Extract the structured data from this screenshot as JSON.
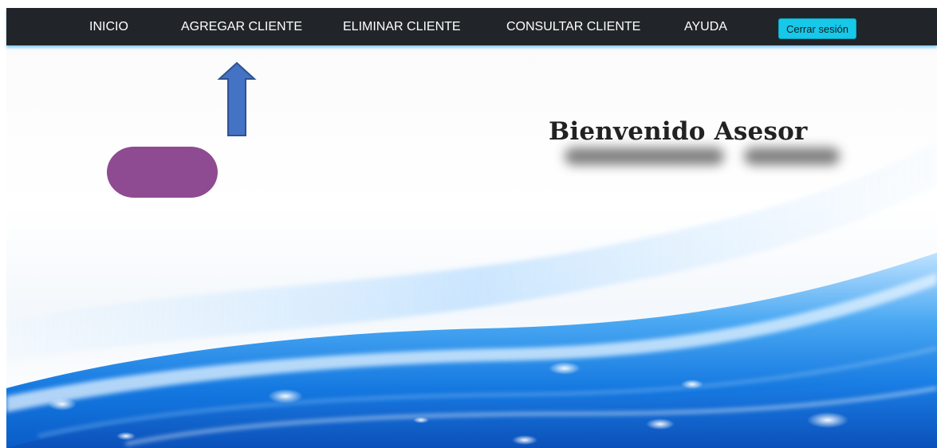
{
  "navbar": {
    "items": [
      {
        "label": "INICIO"
      },
      {
        "label": "AGREGAR CLIENTE"
      },
      {
        "label": "ELIMINAR CLIENTE"
      },
      {
        "label": "CONSULTAR CLIENTE"
      },
      {
        "label": "AYUDA"
      }
    ],
    "logout_label": "Cerrar sesión"
  },
  "main": {
    "welcome_text": "Bienvenido Asesor"
  },
  "colors": {
    "navbar_bg": "#212529",
    "logout_button_bg": "#17c8e8",
    "annotation_arrow": "#4472c4",
    "annotation_blob": "#8e4b91",
    "wave_accent": "#1e8ff0"
  },
  "annotations": {
    "arrow_icon": "up-arrow-icon",
    "blob_shape": "rounded-blob"
  }
}
